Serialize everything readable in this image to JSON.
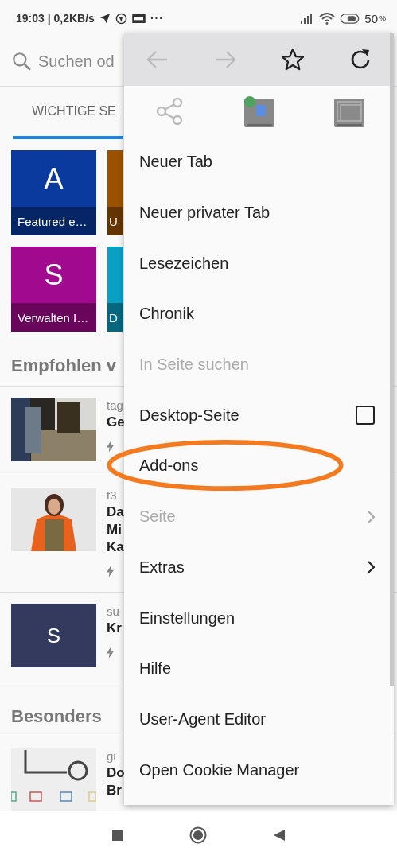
{
  "status_bar": {
    "time": "19:03 | 0,2KB/s",
    "more": "···",
    "battery": "50",
    "battery_unit": "%"
  },
  "search": {
    "placeholder": "Suchen od"
  },
  "tabs": [
    {
      "label": "WICHTIGE SE",
      "selected": true
    }
  ],
  "tiles": [
    {
      "letter": "A",
      "caption": "Featured e…",
      "color": "#0a3a9e"
    },
    {
      "caption": "U",
      "color": "#9a5200"
    },
    {
      "letter": "S",
      "caption": "Verwalten I…",
      "color": "#a10a8e"
    },
    {
      "caption": "D",
      "color": "#0aa0c4"
    }
  ],
  "sections": [
    {
      "heading": "Empfohlen v",
      "articles": [
        {
          "thumb": {
            "kind": "picture"
          },
          "source": "tag",
          "title": [
            "Ge"
          ],
          "fast": true
        },
        {
          "thumb": {
            "kind": "picture"
          },
          "source": "t3",
          "title": [
            "Da",
            "Mi",
            "Ka"
          ],
          "fast": true
        },
        {
          "thumb": {
            "kind": "letter",
            "letter": "S",
            "color": "#343a5e"
          },
          "source": "su",
          "title": [
            "Kr"
          ],
          "fast": true
        }
      ]
    },
    {
      "heading": "Besonders",
      "articles": [
        {
          "thumb": {
            "kind": "picture"
          },
          "source": "gi",
          "title": [
            "Do",
            "Br"
          ]
        }
      ]
    }
  ],
  "menu": {
    "toolbar": [
      {
        "kind": "back",
        "disabled": true
      },
      {
        "kind": "forward",
        "disabled": true
      },
      {
        "kind": "star",
        "disabled": false
      },
      {
        "kind": "reload",
        "disabled": false
      }
    ],
    "actions": [
      {
        "kind": "share",
        "disabled": true
      },
      {
        "kind": "translate"
      },
      {
        "kind": "windows"
      }
    ],
    "items": [
      {
        "label": "Neuer Tab",
        "kind": "plain",
        "disabled": false,
        "circled": false
      },
      {
        "label": "Neuer privater Tab",
        "kind": "plain",
        "disabled": false,
        "circled": false
      },
      {
        "label": "Lesezeichen",
        "kind": "plain",
        "disabled": false,
        "circled": false
      },
      {
        "label": "Chronik",
        "kind": "plain",
        "disabled": false,
        "circled": false
      },
      {
        "label": "In Seite suchen",
        "kind": "plain",
        "disabled": true,
        "circled": false
      },
      {
        "label": "Desktop-Seite",
        "kind": "checkbox",
        "checked": false,
        "disabled": false,
        "circled": false
      },
      {
        "label": "Add-ons",
        "kind": "plain",
        "disabled": false,
        "circled": true
      },
      {
        "label": "Seite",
        "kind": "submenu",
        "disabled": true,
        "circled": false
      },
      {
        "label": "Extras",
        "kind": "submenu",
        "disabled": false,
        "circled": false
      },
      {
        "label": "Einstellungen",
        "kind": "plain",
        "disabled": false,
        "circled": false
      },
      {
        "label": "Hilfe",
        "kind": "plain",
        "disabled": false,
        "circled": false
      },
      {
        "label": "User-Agent Editor",
        "kind": "plain",
        "disabled": false,
        "circled": false
      },
      {
        "label": "Open Cookie Manager",
        "kind": "plain",
        "disabled": false,
        "circled": false
      }
    ]
  }
}
